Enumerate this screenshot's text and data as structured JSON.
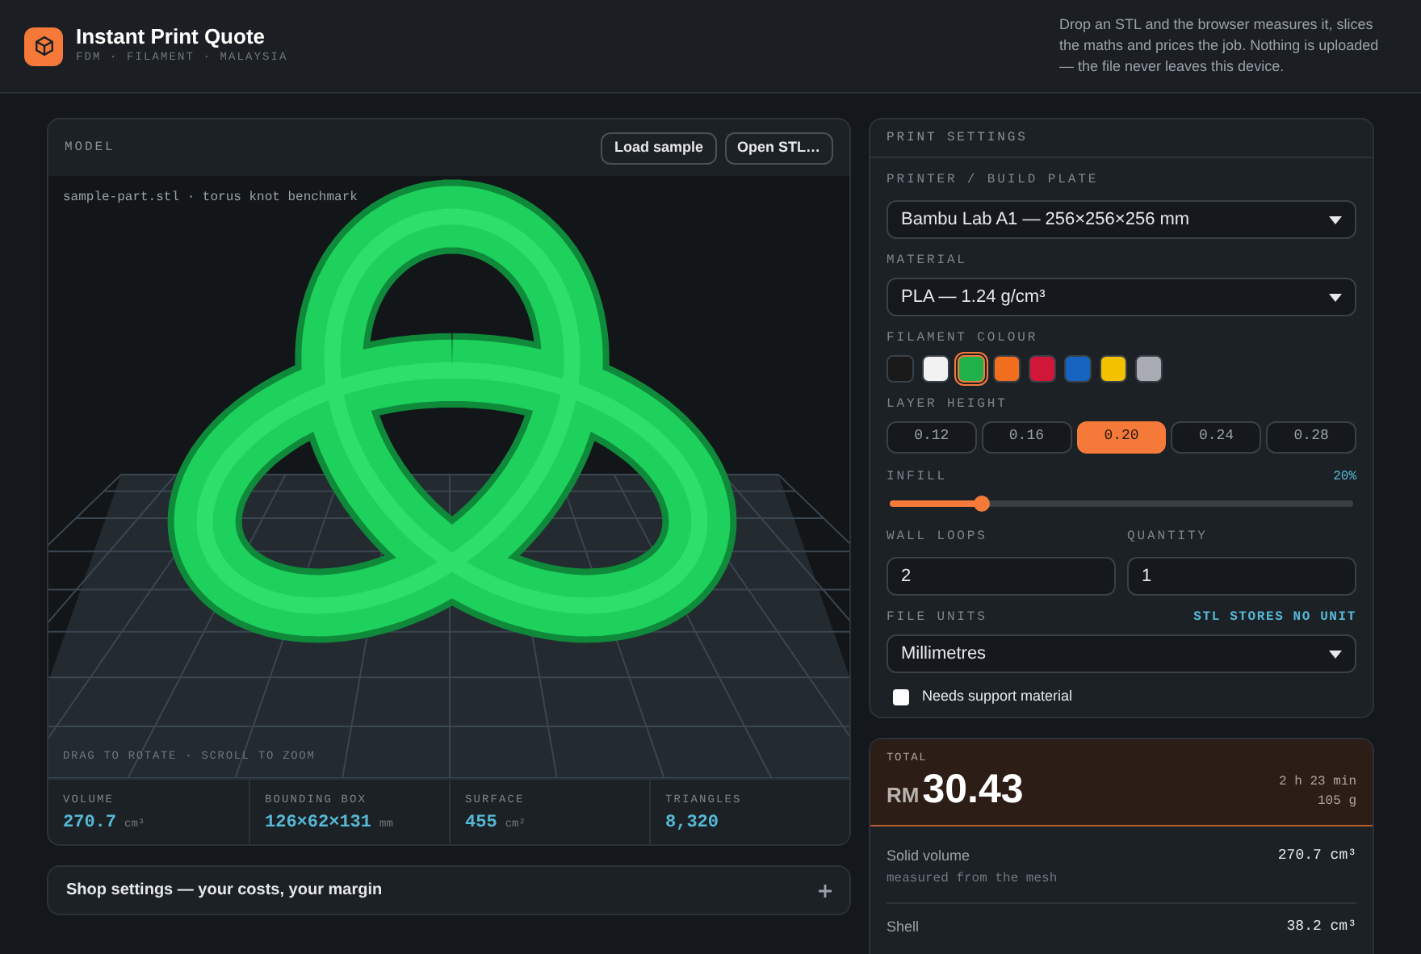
{
  "header": {
    "title": "Instant Print Quote",
    "subtitle": "FDM · FILAMENT · MALAYSIA",
    "description": "Drop an STL and the browser measures it, slices the maths and prices the job. Nothing is uploaded — the file never leaves this device."
  },
  "model": {
    "title": "MODEL",
    "buttons": [
      "Load sample",
      "Open STL…"
    ],
    "file_caption": "sample-part.stl · torus knot benchmark",
    "hint": "DRAG TO ROTATE · SCROLL TO ZOOM",
    "stats": [
      {
        "label": "VOLUME",
        "value": "270.7",
        "unit": "cm³"
      },
      {
        "label": "BOUNDING BOX",
        "value": "126×62×131",
        "unit": "mm"
      },
      {
        "label": "SURFACE",
        "value": "455",
        "unit": "cm²"
      },
      {
        "label": "TRIANGLES",
        "value": "8,320"
      }
    ]
  },
  "shop_settings": {
    "title": "Shop settings — your costs, your margin",
    "expanded": false
  },
  "settings": {
    "title": "PRINT SETTINGS",
    "printer": {
      "label": "PRINTER / BUILD PLATE",
      "value": "Bambu Lab A1 — 256×256×256 mm"
    },
    "material": {
      "label": "MATERIAL",
      "value": "PLA — 1.24 g/cm³"
    },
    "filament": {
      "label": "FILAMENT COLOUR",
      "swatches": [
        {
          "color": "#1a1a1a",
          "selected": false
        },
        {
          "color": "#f2f2f2",
          "selected": false
        },
        {
          "color": "#1fb24a",
          "selected": true
        },
        {
          "color": "#f26f1d",
          "selected": false
        },
        {
          "color": "#d0173a",
          "selected": false
        },
        {
          "color": "#1565c0",
          "selected": false
        },
        {
          "color": "#f2c200",
          "selected": false
        },
        {
          "color": "#a9adb3",
          "selected": false
        }
      ]
    },
    "layer_height": {
      "label": "LAYER HEIGHT",
      "options": [
        {
          "label": "0.12",
          "selected": false
        },
        {
          "label": "0.16",
          "selected": false
        },
        {
          "label": "0.20",
          "selected": true
        },
        {
          "label": "0.24",
          "selected": false
        },
        {
          "label": "0.28",
          "selected": false
        }
      ]
    },
    "infill": {
      "label": "INFILL",
      "reading": "20%",
      "level": 0.2
    },
    "wall_loops": {
      "label": "WALL LOOPS",
      "value": "2"
    },
    "quantity": {
      "label": "QUANTITY",
      "value": "1"
    },
    "file_units": {
      "label": "FILE UNITS",
      "note": "STL STORES NO UNIT",
      "value": "Millimetres"
    },
    "support": {
      "label": "Needs support material",
      "checked": false
    }
  },
  "total": {
    "label": "TOTAL",
    "currency": "RM",
    "amount": "30.43",
    "time": "2 h 23 min",
    "weight": "105 g",
    "breakdown": [
      {
        "label": "Solid volume",
        "sub": "measured from the mesh",
        "value": "270.7 cm³"
      },
      {
        "label": "Shell",
        "value": "38.2 cm³"
      }
    ]
  }
}
